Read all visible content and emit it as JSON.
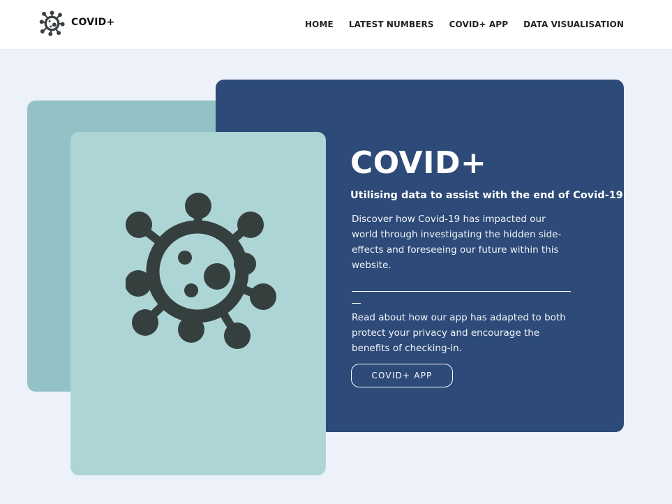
{
  "header": {
    "logo_text": "COVID+",
    "logo_icon": "virus-icon",
    "nav": [
      {
        "label": "HOME"
      },
      {
        "label": "LATEST NUMBERS"
      },
      {
        "label": "COVID+ APP"
      },
      {
        "label": "DATA VISUALISATION"
      }
    ]
  },
  "hero": {
    "title": "COVID+",
    "subtitle": "Utilising data to assist with the end of Covid-19.",
    "paragraph1": "Discover how Covid-19 has impacted our world through investigating the hidden side-effects and foreseeing our future within this website.",
    "paragraph2": "Read about how our app has adapted to both protect your privacy and encourage the benefits of checking-in.",
    "button_label": "COVID+ APP",
    "illustration_icon": "virus-icon"
  },
  "colors": {
    "page_bg": "#edf1fa",
    "navy_card": "#2d4a78",
    "teal_card": "#92c2c5",
    "light_card": "#add5d6",
    "icon": "#353f3e"
  }
}
